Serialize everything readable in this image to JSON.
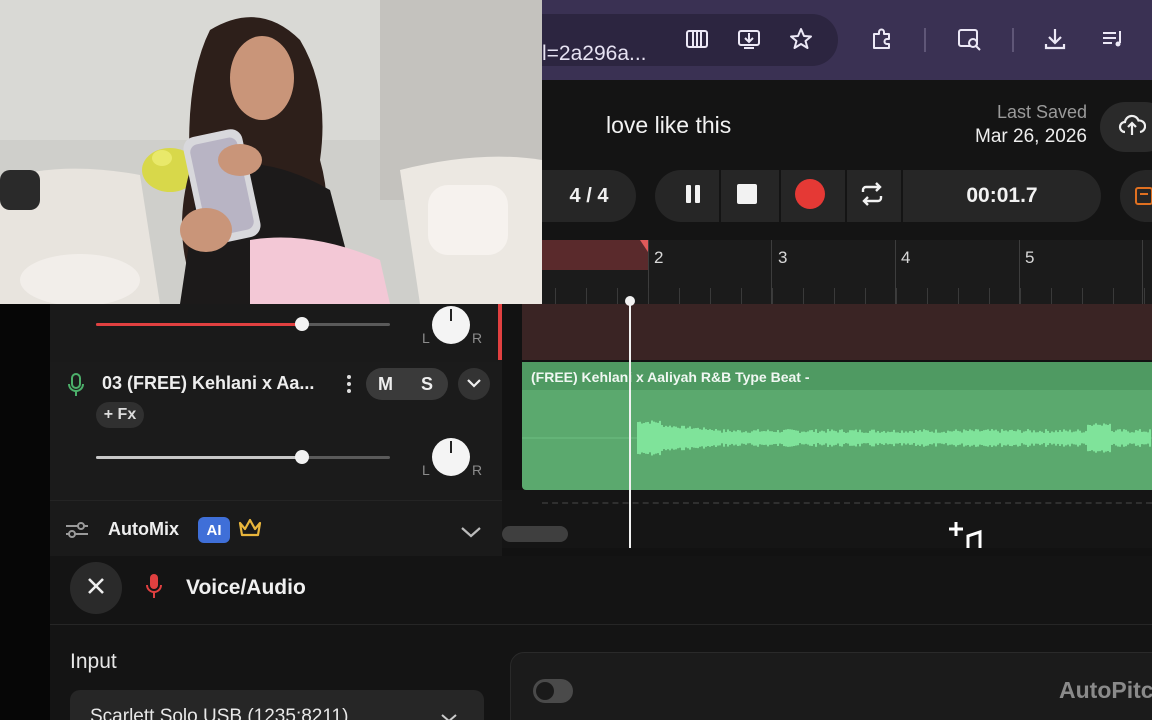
{
  "browser": {
    "url_fragment": "l=2a296a...",
    "icons": [
      "piano-icon",
      "install-app-icon",
      "star-icon",
      "extensions-icon",
      "tab-search-icon",
      "download-icon",
      "queue-icon"
    ]
  },
  "header": {
    "project_title": "love like this",
    "last_saved_label": "Last Saved",
    "last_saved_date": "Mar 26, 2026"
  },
  "transport": {
    "time_signature": "4 / 4",
    "time": "00:01.7"
  },
  "ruler": {
    "bars": [
      "2",
      "3",
      "4",
      "5"
    ]
  },
  "track": {
    "name": "03 (FREE) Kehlani x Aa...",
    "mute_label": "M",
    "solo_label": "S",
    "fx_label": "+ Fx",
    "pan_left": "L",
    "pan_right": "R",
    "volume_top": 0.7,
    "volume_bottom": 0.7
  },
  "clip": {
    "title": "(FREE) Kehlani x Aaliyah R&B Type Beat -"
  },
  "automix": {
    "label": "AutoMix",
    "badge": "AI"
  },
  "voice_panel": {
    "title": "Voice/Audio",
    "input_label": "Input",
    "input_device": "Scarlett Solo USB (1235:8211)",
    "autopitch_label": "AutoPitch",
    "autopitch_enabled": false
  },
  "colors": {
    "browser_bar": "#3a3153",
    "record": "#e53935",
    "clip_green": "#5ba96e",
    "waveform": "#7fe39a",
    "ai_badge": "#3f6fd8",
    "crown": "#e9b63c",
    "mic_green": "#4caf6a",
    "mic_red": "#e04040"
  }
}
